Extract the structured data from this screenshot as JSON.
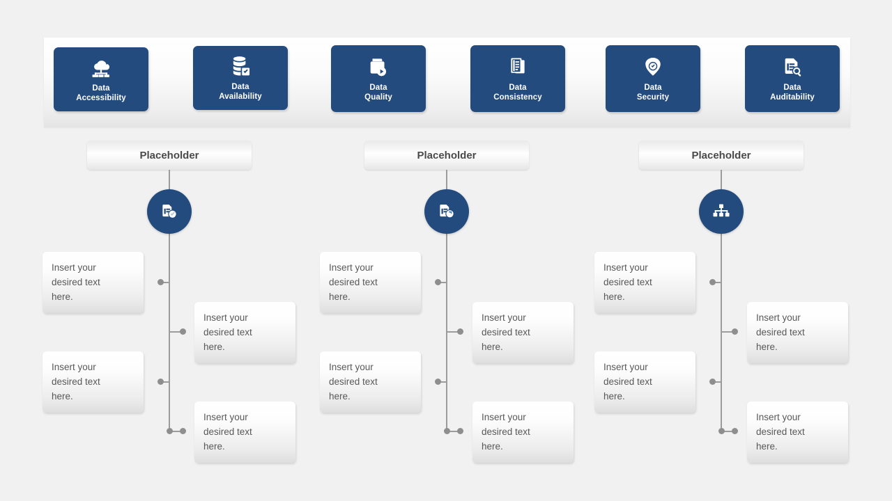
{
  "background_color": "#f1f1f1",
  "accent_color": "#244b7e",
  "connector_color": "#9c9c9c",
  "banner": {
    "name": "data-capabilities-banner",
    "cards": [
      {
        "label": "Data\nAccessibility",
        "icon": "cloud-network-icon"
      },
      {
        "label": "Data\nAvailability",
        "icon": "database-check-icon"
      },
      {
        "label": "Data\nQuality",
        "icon": "folder-play-icon"
      },
      {
        "label": "Data\nConsistency",
        "icon": "documents-stack-icon"
      },
      {
        "label": "Data\nSecurity",
        "icon": "shield-check-icon"
      },
      {
        "label": "Data\nAuditability",
        "icon": "document-search-icon"
      }
    ]
  },
  "columns": [
    {
      "header": "Placeholder",
      "hub_icon": "document-check-icon",
      "items": [
        {
          "text": "Insert your\ndesired text\nhere.",
          "side": "left"
        },
        {
          "text": "Insert your\ndesired text\nhere.",
          "side": "right"
        },
        {
          "text": "Insert your\ndesired text\nhere.",
          "side": "left"
        },
        {
          "text": "Insert your\ndesired text\nhere.",
          "side": "right"
        }
      ]
    },
    {
      "header": "Placeholder",
      "hub_icon": "document-gear-icon",
      "items": [
        {
          "text": "Insert your\ndesired text\nhere.",
          "side": "left"
        },
        {
          "text": "Insert your\ndesired text\nhere.",
          "side": "right"
        },
        {
          "text": "Insert your\ndesired text\nhere.",
          "side": "left"
        },
        {
          "text": "Insert your\ndesired text\nhere.",
          "side": "right"
        }
      ]
    },
    {
      "header": "Placeholder",
      "hub_icon": "hierarchy-icon",
      "items": [
        {
          "text": "Insert your\ndesired text\nhere.",
          "side": "left"
        },
        {
          "text": "Insert your\ndesired text\nhere.",
          "side": "right"
        },
        {
          "text": "Insert your\ndesired text\nhere.",
          "side": "left"
        },
        {
          "text": "Insert your\ndesired text\nhere.",
          "side": "right"
        }
      ]
    }
  ]
}
